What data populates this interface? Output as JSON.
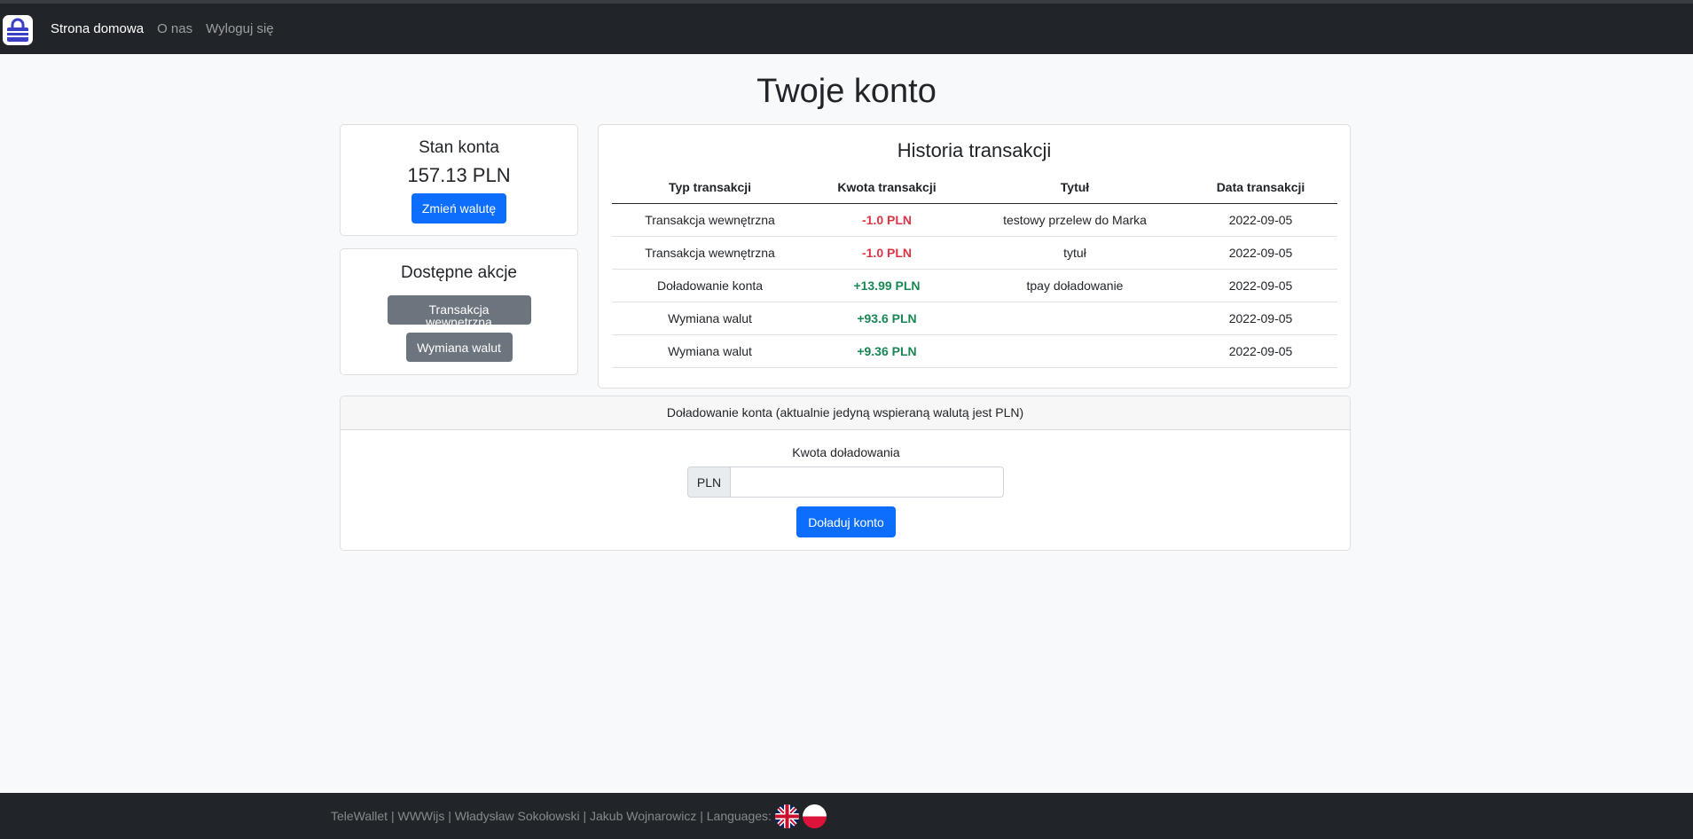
{
  "nav": {
    "links": [
      {
        "label": "Strona domowa",
        "active": true
      },
      {
        "label": "O nas",
        "active": false
      },
      {
        "label": "Wyloguj się",
        "active": false
      }
    ]
  },
  "page": {
    "title": "Twoje konto"
  },
  "balance": {
    "title": "Stan konta",
    "amount": "157.13 PLN",
    "change_currency_label": "Zmień walutę"
  },
  "actions": {
    "title": "Dostępne akcje",
    "internal_transfer_label": "Transakcja wewnętrzna",
    "exchange_label": "Wymiana walut"
  },
  "history": {
    "title": "Historia transakcji",
    "columns": [
      "Typ transakcji",
      "Kwota transakcji",
      "Tytuł",
      "Data transakcji"
    ],
    "rows": [
      {
        "type": "Transakcja wewnętrzna",
        "amount": "-1.0 PLN",
        "sign": "neg",
        "title": "testowy przelew do Marka",
        "date": "2022-09-05"
      },
      {
        "type": "Transakcja wewnętrzna",
        "amount": "-1.0 PLN",
        "sign": "neg",
        "title": "tytuł",
        "date": "2022-09-05"
      },
      {
        "type": "Doładowanie konta",
        "amount": "+13.99 PLN",
        "sign": "pos",
        "title": "tpay doładowanie",
        "date": "2022-09-05"
      },
      {
        "type": "Wymiana walut",
        "amount": "+93.6 PLN",
        "sign": "pos",
        "title": "",
        "date": "2022-09-05"
      },
      {
        "type": "Wymiana walut",
        "amount": "+9.36 PLN",
        "sign": "pos",
        "title": "",
        "date": "2022-09-05"
      }
    ],
    "negative_color": "#dc3545",
    "positive_color": "#198754"
  },
  "topup": {
    "header": "Doładowanie konta (aktualnie jedyną wspieraną walutą jest PLN)",
    "field_label": "Kwota doładowania",
    "currency_addon": "PLN",
    "amount_value": "",
    "submit_label": "Doładuj konto"
  },
  "footer": {
    "text": "TeleWallet | WWWijs | Władysław Sokołowski | Jakub Wojnarowicz | Languages:",
    "languages": [
      {
        "name": "english",
        "icon": "uk-flag-icon"
      },
      {
        "name": "polish",
        "icon": "poland-flag-icon"
      }
    ]
  },
  "colors": {
    "navbar": "#212529",
    "primary": "#0d6efd",
    "secondary": "#6c757d",
    "logo_accent": "#3a3fc4"
  }
}
